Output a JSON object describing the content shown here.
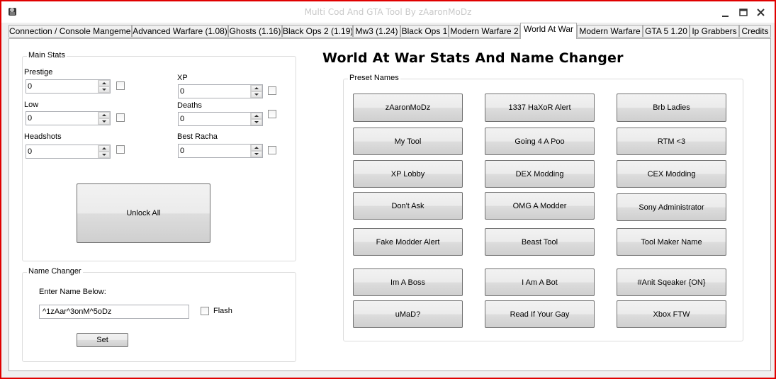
{
  "window": {
    "title": "Multi Cod And GTA Tool By zAaronMoDz"
  },
  "tabs": [
    {
      "label": "Connection / Console Mangement"
    },
    {
      "label": "Advanced Warfare (1.08)"
    },
    {
      "label": "Ghosts (1.16)"
    },
    {
      "label": "Black Ops 2 (1.19)"
    },
    {
      "label": "Mw3 (1.24)"
    },
    {
      "label": "Black Ops 1"
    },
    {
      "label": "Modern Warfare 2"
    },
    {
      "label": "World At War"
    },
    {
      "label": "Modern Warfare"
    },
    {
      "label": "GTA 5 1.20"
    },
    {
      "label": "Ip Grabbers"
    },
    {
      "label": "Credits"
    }
  ],
  "active_tab": "World At War",
  "main_stats": {
    "legend": "Main Stats",
    "fields": [
      {
        "label": "Prestige",
        "value": "0"
      },
      {
        "label": "XP",
        "value": "0"
      },
      {
        "label": "Low",
        "value": "0"
      },
      {
        "label": "Deaths",
        "value": "0"
      },
      {
        "label": "Headshots",
        "value": "0"
      },
      {
        "label": "Best Racha",
        "value": "0"
      }
    ],
    "unlock_all_label": "Unlock All"
  },
  "name_changer": {
    "legend": "Name Changer",
    "prompt": "Enter Name Below:",
    "value": "^1zAar^3onM^5oDz",
    "flash_label": "Flash",
    "set_label": "Set"
  },
  "heading": "World At War Stats And Name Changer",
  "preset_names": {
    "legend": "Preset Names",
    "buttons": [
      "zAaronMoDz",
      "1337 HaXoR Alert",
      "Brb Ladies",
      "My Tool",
      "Going 4 A Poo",
      "RTM <3",
      "XP Lobby",
      "DEX Modding",
      "CEX Modding",
      "Don't Ask",
      "OMG A Modder",
      "Sony Administrator",
      "Fake Modder Alert",
      "Beast Tool",
      "Tool Maker Name",
      "Im A Boss",
      "I Am A Bot",
      "#Anit Sqeaker {ON}",
      "uMaD?",
      "Read If Your Gay",
      "Xbox FTW"
    ]
  },
  "icons": {
    "app": "app-icon",
    "minimize": "minimize-icon",
    "maximize": "maximize-icon",
    "close": "close-icon"
  },
  "colors": {
    "frame_border": "#e00000"
  }
}
